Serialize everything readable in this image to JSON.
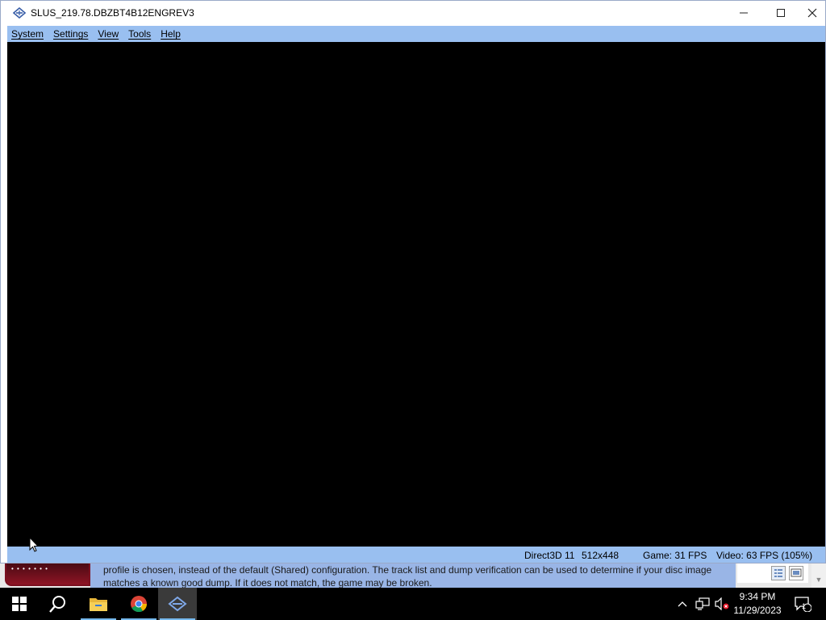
{
  "window": {
    "title": "SLUS_219.78.DBZBT4B12ENGREV3",
    "icon": "pcsx2-icon"
  },
  "menu": [
    "System",
    "Settings",
    "View",
    "Tools",
    "Help"
  ],
  "status": {
    "renderer": "Direct3D 11",
    "resolution": "512x448",
    "game_fps": "Game: 31 FPS",
    "video_fps": "Video: 63 FPS (105%)"
  },
  "background_app": {
    "thumb_text": "• • • • • • •",
    "description_lines": [
      "profile is chosen, instead of the default (Shared) configuration. The track list and dump verification can be used to determine if your disc image",
      "matches a known good dump. If it does not match, the game may be broken."
    ]
  },
  "taskbar": {
    "apps": [
      "start-icon",
      "search-icon",
      "file-explorer-icon",
      "chrome-icon",
      "pcsx2-icon"
    ],
    "clock_time": "9:34 PM",
    "clock_date": "11/29/2023",
    "notification_count": "1"
  },
  "colors": {
    "menu_bar": "#99bff0",
    "status_bar": "#99bff0",
    "display": "#000000",
    "taskbar": "#000000"
  }
}
